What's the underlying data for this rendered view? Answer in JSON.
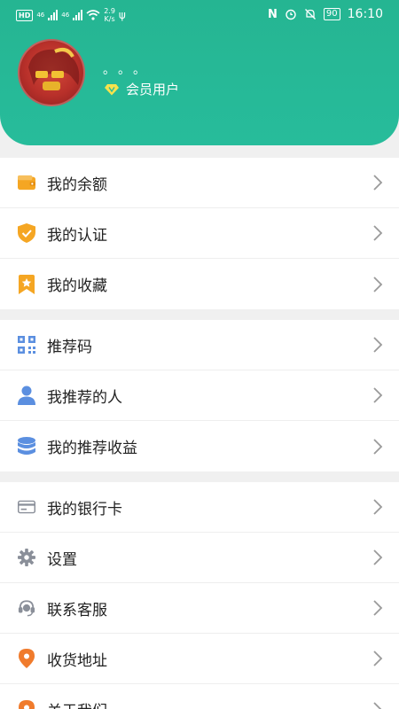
{
  "status_bar": {
    "left_badge": "HD",
    "net1": "46",
    "net2": "46",
    "speed_value": "2.9",
    "speed_unit": "K/s",
    "battery": "90",
    "time": "16:10"
  },
  "profile": {
    "username": "。。。",
    "member_label": "会员用户"
  },
  "menu": {
    "group1": [
      {
        "label": "我的余额",
        "icon": "wallet-icon"
      },
      {
        "label": "我的认证",
        "icon": "verified-shield-icon"
      },
      {
        "label": "我的收藏",
        "icon": "bookmark-star-icon"
      }
    ],
    "group2": [
      {
        "label": "推荐码",
        "icon": "qr-code-icon"
      },
      {
        "label": "我推荐的人",
        "icon": "person-icon"
      },
      {
        "label": "我的推荐收益",
        "icon": "coins-stack-icon"
      }
    ],
    "group3": [
      {
        "label": "我的银行卡",
        "icon": "bank-card-icon"
      },
      {
        "label": "设置",
        "icon": "gear-icon"
      },
      {
        "label": "联系客服",
        "icon": "headset-icon"
      },
      {
        "label": "收货地址",
        "icon": "location-pin-icon"
      },
      {
        "label": "关于我们",
        "icon": "about-pin-icon"
      }
    ]
  },
  "colors": {
    "header": "#27bc9b",
    "wallet": "#f5a623",
    "shield": "#f5a623",
    "bookmark": "#f5a623",
    "blue": "#5b8fe0",
    "gray": "#8a8f99",
    "orange": "#f07b2c"
  }
}
